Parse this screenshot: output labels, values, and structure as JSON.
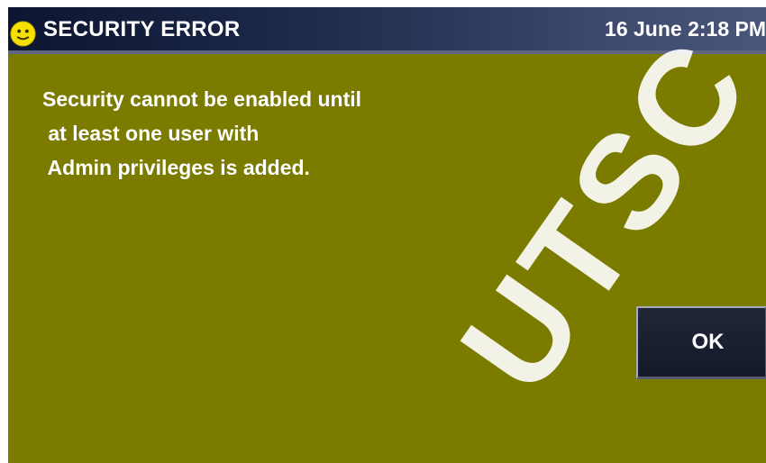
{
  "header": {
    "title": "SECURITY ERROR",
    "datetime": "16 June 2:18 PM",
    "icon": "smiley-face-icon"
  },
  "message": {
    "lines": [
      "Security cannot be enabled until",
      " at least one user with",
      " Admin privileges is added."
    ]
  },
  "actions": {
    "ok_label": "OK"
  },
  "watermark": {
    "text": "UTSC"
  },
  "colors": {
    "background": "#7b7b00",
    "titlebar_dark": "#0c1630",
    "titlebar_light": "#4a5679",
    "button": "#1f2638",
    "text": "#ffffff",
    "icon": "#f5e000"
  }
}
